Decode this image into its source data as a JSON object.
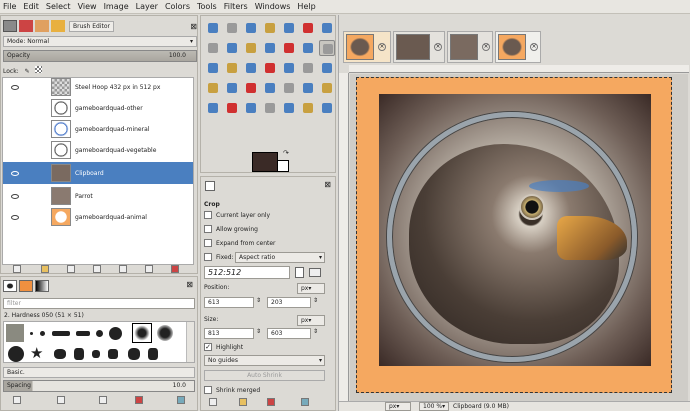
{
  "menu": [
    "File",
    "Edit",
    "Select",
    "View",
    "Image",
    "Layer",
    "Colors",
    "Tools",
    "Filters",
    "Windows",
    "Help"
  ],
  "layers_panel": {
    "tab_label": "Brush Editor",
    "mode_label": "Mode: Normal",
    "opacity_label": "Opacity",
    "opacity_value": "100.0",
    "lock_label": "Lock:",
    "layers": [
      {
        "name": "Steel Hoop 432 px in 512 px",
        "visible": true,
        "selected": false
      },
      {
        "name": "gameboardquad-other",
        "visible": false,
        "selected": false
      },
      {
        "name": "gameboardquad-mineral",
        "visible": false,
        "selected": false
      },
      {
        "name": "gameboardquad-vegetable",
        "visible": false,
        "selected": false
      },
      {
        "name": "Clipboard",
        "visible": true,
        "selected": true
      },
      {
        "name": "Parrot",
        "visible": true,
        "selected": false
      },
      {
        "name": "gameboardquad-animal",
        "visible": true,
        "selected": false
      }
    ]
  },
  "brushes_panel": {
    "filter_placeholder": "filter",
    "brush_name": "2. Hardness 050 (51 × 51)",
    "preset": "Basic.",
    "spacing_label": "Spacing",
    "spacing_value": "10.0"
  },
  "tool_options": {
    "title": "Crop",
    "current_layer_only": "Current layer only",
    "allow_growing": "Allow growing",
    "expand_from_center": "Expand from center",
    "fixed_label": "Fixed:",
    "fixed_value": "Aspect ratio",
    "ratio": "512:512",
    "position_label": "Position:",
    "position_unit": "px",
    "position_x": "613",
    "position_y": "203",
    "size_label": "Size:",
    "size_unit": "px",
    "size_w": "813",
    "size_h": "603",
    "highlight": "Highlight",
    "guides": "No guides",
    "auto_shrink": "Auto Shrink",
    "shrink_merged": "Shrink merged"
  },
  "colors": {
    "foreground": "#3a2a26",
    "background": "#ffffff",
    "accent": "#4a7fc0",
    "canvas_border": "#f5a860"
  },
  "statusbar": {
    "unit": "px",
    "zoom": "100 %",
    "info": "Clipboard (9.0 MB)"
  }
}
